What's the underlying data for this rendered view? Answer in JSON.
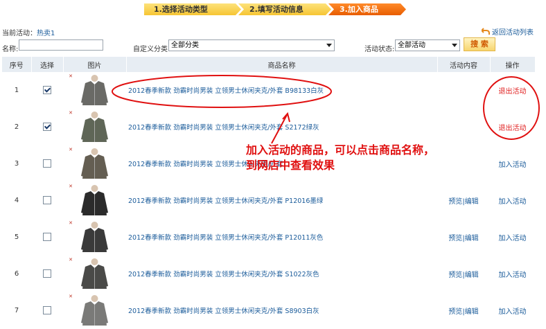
{
  "steps": [
    "1.选择活动类型",
    "2.填写活动信息",
    "3.加入商品"
  ],
  "current": {
    "label": "当前活动：",
    "value": "热卖1"
  },
  "back_link": "返回活动列表",
  "filter": {
    "name_label": "名称:",
    "name_value": "",
    "category_label": "自定义分类:",
    "category_value": "全部分类",
    "status_label": "活动状态:",
    "status_value": "全部活动",
    "search_button": "搜 索"
  },
  "table": {
    "headers": [
      "序号",
      "选择",
      "图片",
      "商品名称",
      "活动内容",
      "操作"
    ],
    "rows": [
      {
        "no": "1",
        "checked": true,
        "name": "2012春季新款  劲霸时尚男装  立领男士休闲夹克/外套  B98133白灰",
        "preview": "",
        "edit": "",
        "action": "退出活动",
        "action_type": "exit",
        "jacket": "#6a6a66"
      },
      {
        "no": "2",
        "checked": true,
        "name": "2012春季新款  劲霸时尚男装  立领男士休闲夹克/外套  S2172绿灰",
        "preview": "",
        "edit": "",
        "action": "退出活动",
        "action_type": "exit",
        "jacket": "#5f6657"
      },
      {
        "no": "3",
        "checked": false,
        "name": "2012春季新款  劲霸时尚男装  立领男士休闲夹克/外套",
        "preview": "",
        "edit": "",
        "action": "加入活动",
        "action_type": "join",
        "jacket": "#645e52"
      },
      {
        "no": "4",
        "checked": false,
        "name": "2012春季新款  劲霸时尚男装  立领男士休闲夹克/外套  P12016墨绿",
        "preview": "预览",
        "edit": "编辑",
        "action": "加入活动",
        "action_type": "join",
        "jacket": "#2b2b2b"
      },
      {
        "no": "5",
        "checked": false,
        "name": "2012春季新款  劲霸时尚男装  立领男士休闲夹克/外套  P12011灰色",
        "preview": "预览",
        "edit": "编辑",
        "action": "加入活动",
        "action_type": "join",
        "jacket": "#3a3a3a"
      },
      {
        "no": "6",
        "checked": false,
        "name": "2012春季新款  劲霸时尚男装  立领男士休闲夹克/外套  S1022灰色",
        "preview": "预览",
        "edit": "编辑",
        "action": "加入活动",
        "action_type": "join",
        "jacket": "#4a4a48"
      },
      {
        "no": "7",
        "checked": false,
        "name": "2012春季新款  劲霸时尚男装  立领男士休闲夹克/外套  S8903白灰",
        "preview": "预览",
        "edit": "编辑",
        "action": "加入活动",
        "action_type": "join",
        "jacket": "#7a7a78"
      }
    ]
  },
  "annotation": [
    "加入活动的商品，可以点击商品名称，",
    "到网店中查看效果"
  ],
  "colors": {
    "accent": "#e85d00",
    "link": "#1a5b9a",
    "exit": "#e02020",
    "header_bg": "#e7edf3",
    "annotation": "#e01010"
  }
}
